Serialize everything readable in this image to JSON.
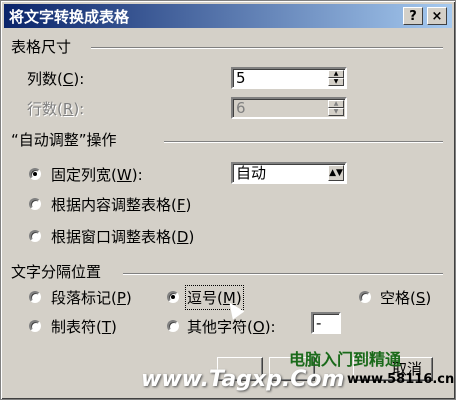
{
  "window": {
    "title": "将文字转换成表格",
    "help_button": "?",
    "close_button": "×"
  },
  "table_size": {
    "group_title": "表格尺寸",
    "columns_label": "列数",
    "columns_key": "C",
    "columns_value": "5",
    "rows_label": "行数",
    "rows_key": "R",
    "rows_value": "6"
  },
  "autofit": {
    "group_title": "“自动调整”操作",
    "fixed_label": "固定列宽",
    "fixed_key": "W",
    "fixed_value": "自动",
    "content_label": "根据内容调整表格",
    "content_key": "F",
    "window_label": "根据窗口调整表格",
    "window_key": "D"
  },
  "separator": {
    "group_title": "文字分隔位置",
    "paragraph_label": "段落标记",
    "paragraph_key": "P",
    "comma_label": "逗号",
    "comma_key": "M",
    "space_label": "空格",
    "space_key": "S",
    "tab_label": "制表符",
    "tab_key": "T",
    "other_label": "其他字符",
    "other_key": "O",
    "other_value": "-"
  },
  "watermarks": {
    "site1": "www.Tagxp.Com",
    "site2": "电脑入门到精通",
    "site3": "www.58116.cn",
    "cancel_fragment": "取消"
  }
}
